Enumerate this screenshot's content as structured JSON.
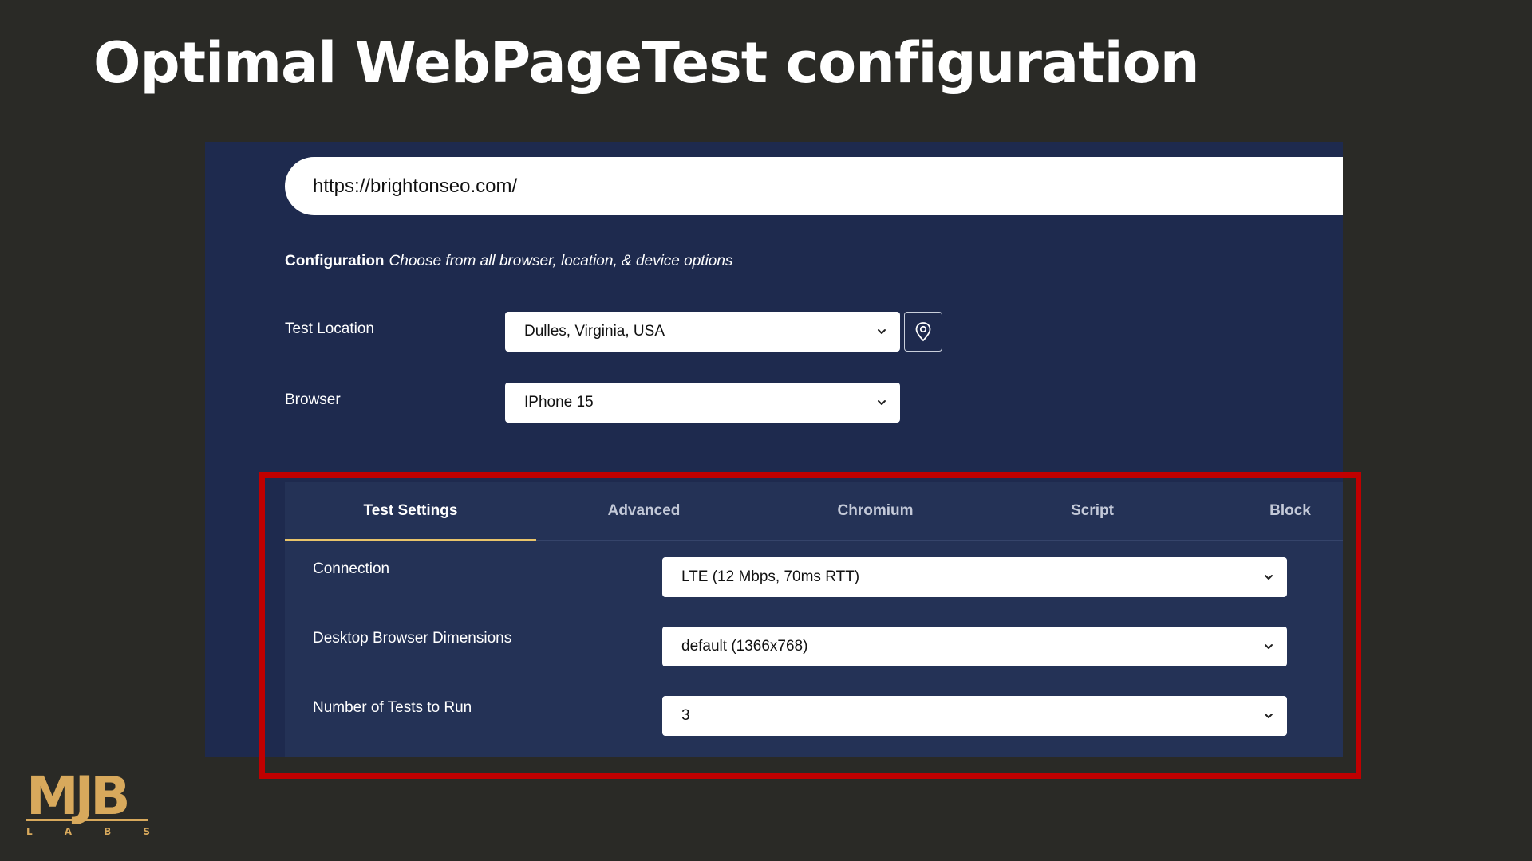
{
  "slide": {
    "title": "Optimal WebPageTest configuration"
  },
  "url_bar": {
    "value": "https://brightonseo.com/"
  },
  "configuration": {
    "label": "Configuration",
    "description": "Choose from all browser, location, & device options"
  },
  "test_location": {
    "label": "Test Location",
    "value": "Dulles, Virginia, USA",
    "map_button_icon": "map-pin-icon"
  },
  "browser": {
    "label": "Browser",
    "value": "IPhone 15"
  },
  "tabs": [
    {
      "label": "Test Settings",
      "active": true
    },
    {
      "label": "Advanced",
      "active": false
    },
    {
      "label": "Chromium",
      "active": false
    },
    {
      "label": "Script",
      "active": false
    },
    {
      "label": "Block",
      "active": false
    }
  ],
  "settings": {
    "connection": {
      "label": "Connection",
      "value": "LTE (12 Mbps, 70ms RTT)"
    },
    "dimensions": {
      "label": "Desktop Browser Dimensions",
      "value": "default (1366x768)"
    },
    "num_tests": {
      "label": "Number of Tests to Run",
      "value": "3"
    }
  },
  "logo": {
    "mark": "MJB",
    "sub_letters": [
      "L",
      "A",
      "B",
      "S"
    ]
  },
  "colors": {
    "slide_background": "#2a2a26",
    "panel_background": "#1e2a4e",
    "settings_background": "#243256",
    "highlight_frame": "#c00000",
    "active_tab_underline": "#e8c46a",
    "logo": "#d8a95c"
  }
}
